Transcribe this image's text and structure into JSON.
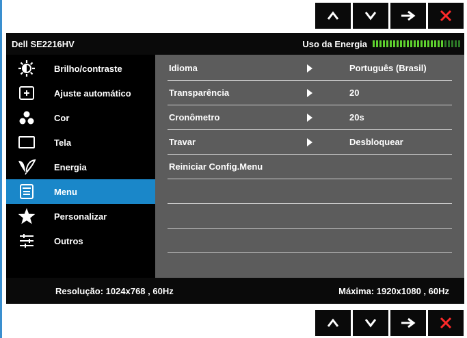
{
  "nav_buttons": {
    "up_icon": "caret-up-icon",
    "down_icon": "caret-down-icon",
    "enter_icon": "arrow-right-icon",
    "exit_icon": "close-icon",
    "exit_color": "#ff2a2a"
  },
  "header": {
    "model": "Dell SE2216HV",
    "energy_label": "Uso da Energia",
    "energy_level": 0.82,
    "meter_on_color": "#5fd12f",
    "meter_off_color": "#2d7a27"
  },
  "sidebar": {
    "items": [
      {
        "label": "Brilho/contraste",
        "icon": "brightness-icon"
      },
      {
        "label": "Ajuste automático",
        "icon": "auto-adjust-icon"
      },
      {
        "label": "Cor",
        "icon": "color-icon"
      },
      {
        "label": "Tela",
        "icon": "display-icon"
      },
      {
        "label": "Energia",
        "icon": "energy-leaf-icon"
      },
      {
        "label": "Menu",
        "icon": "menu-icon",
        "active": true
      },
      {
        "label": "Personalizar",
        "icon": "star-icon"
      },
      {
        "label": "Outros",
        "icon": "sliders-icon"
      }
    ],
    "active_color": "#1a87c9"
  },
  "menu_settings": {
    "rows": [
      {
        "name": "Idioma",
        "value": "Português (Brasil)"
      },
      {
        "name": "Transparência",
        "value": "20"
      },
      {
        "name": "Cronômetro",
        "value": "20s"
      },
      {
        "name": "Travar",
        "value": "Desbloquear"
      },
      {
        "name": "Reiniciar Config.Menu",
        "value": ""
      },
      {
        "name": "",
        "value": ""
      },
      {
        "name": "",
        "value": ""
      },
      {
        "name": "",
        "value": ""
      }
    ]
  },
  "footer": {
    "resolution": "Resolução: 1024x768 , 60Hz",
    "maximum": "Máxima: 1920x1080 , 60Hz"
  }
}
